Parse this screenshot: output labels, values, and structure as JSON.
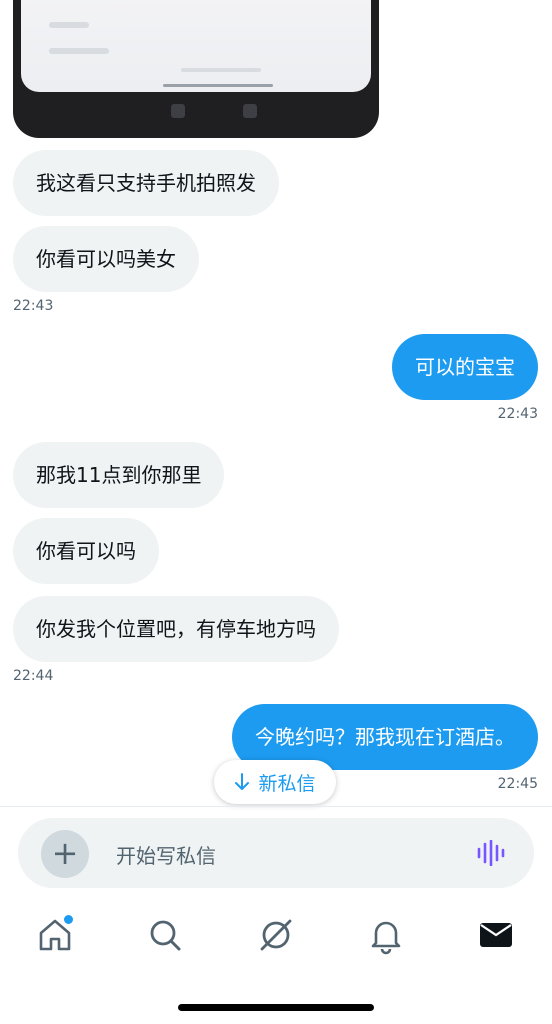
{
  "composer": {
    "placeholder": "开始写私信"
  },
  "new_messages_pill": {
    "label": "新私信"
  },
  "messages": [
    {
      "text": "我这看只支持手机拍照发",
      "direction": "incoming"
    },
    {
      "text": "你看可以吗美女",
      "direction": "incoming",
      "time": "22:43"
    },
    {
      "text": "可以的宝宝",
      "direction": "outgoing",
      "time": "22:43"
    },
    {
      "text": "那我11点到你那里",
      "direction": "incoming"
    },
    {
      "text": "你看可以吗",
      "direction": "incoming"
    },
    {
      "text": "你发我个位置吧，有停车地方吗",
      "direction": "incoming",
      "time": "22:44"
    },
    {
      "text": "今晚约吗？那我现在订酒店。",
      "direction": "outgoing",
      "time": "22:45"
    }
  ],
  "tabs": [
    {
      "name": "home",
      "icon": "home-icon",
      "badge": true
    },
    {
      "name": "search",
      "icon": "search-icon"
    },
    {
      "name": "spaces",
      "icon": "spaces-icon"
    },
    {
      "name": "notifications",
      "icon": "bell-icon"
    },
    {
      "name": "messages",
      "icon": "mail-icon",
      "active": true
    }
  ],
  "colors": {
    "accent": "#1d9bf0",
    "incoming_bubble": "#eff3f4",
    "voice": "#7856ff"
  }
}
